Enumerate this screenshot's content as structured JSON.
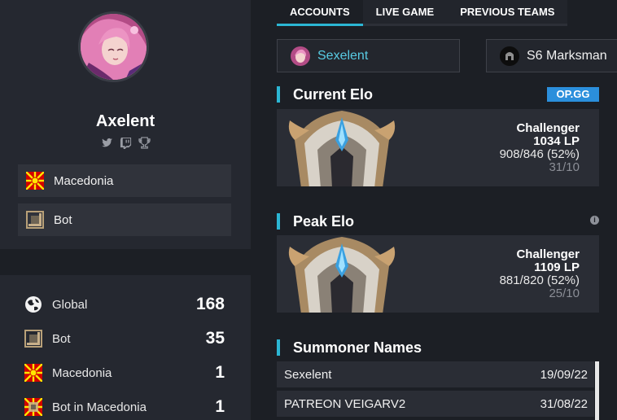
{
  "profile": {
    "name": "Axelent",
    "info": [
      {
        "label": "Macedonia",
        "icon": "macedonia-flag-icon"
      },
      {
        "label": "Bot",
        "icon": "bot-lane-icon"
      }
    ]
  },
  "rankings": [
    {
      "label": "Global",
      "value": "168",
      "icon": "globe-icon"
    },
    {
      "label": "Bot",
      "value": "35",
      "icon": "bot-lane-icon"
    },
    {
      "label": "Macedonia",
      "value": "1",
      "icon": "macedonia-flag-icon"
    },
    {
      "label": "Bot in Macedonia",
      "value": "1",
      "icon": "bot-macedonia-icon"
    }
  ],
  "tabs": [
    "ACCOUNTS",
    "LIVE GAME",
    "PREVIOUS TEAMS"
  ],
  "accounts": {
    "primary": "Sexelent",
    "secondary": "S6 Marksman"
  },
  "current_elo": {
    "title": "Current Elo",
    "badge": "OP.GG",
    "tier": "Challenger",
    "lp": "1034 LP",
    "winloss": "908/846 (52%)",
    "games": "31/10"
  },
  "peak_elo": {
    "title": "Peak Elo",
    "info_icon": "i",
    "tier": "Challenger",
    "lp": "1109 LP",
    "winloss": "881/820 (52%)",
    "games": "25/10"
  },
  "summoner_names": {
    "title": "Summoner Names",
    "rows": [
      {
        "name": "Sexelent",
        "date": "19/09/22"
      },
      {
        "name": "PATREON VEIGARV2",
        "date": "31/08/22"
      }
    ]
  },
  "colors": {
    "accent": "#2bb6d4",
    "opgg": "#2b8fdc",
    "panel": "#252830",
    "background": "#1c1f25"
  }
}
